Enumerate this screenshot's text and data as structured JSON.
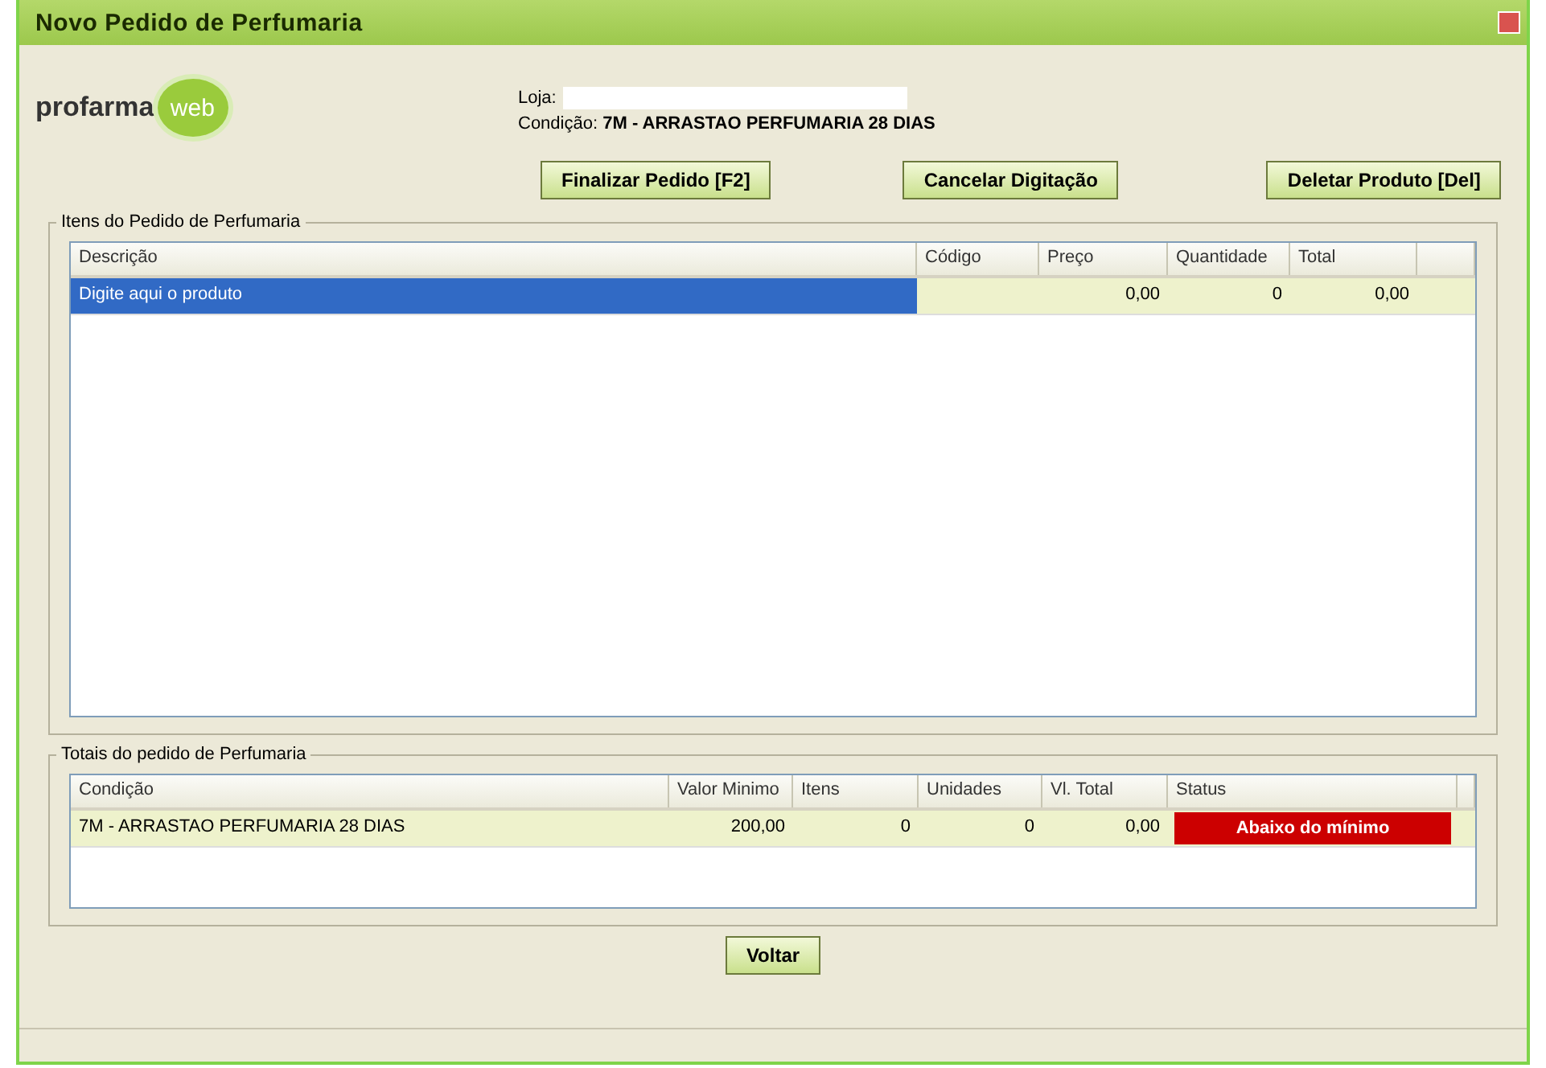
{
  "window": {
    "title": "Novo Pedido de Perfumaria"
  },
  "logo": {
    "text": "profarma",
    "badge": "web"
  },
  "header": {
    "store_label": "Loja:",
    "condition_label": "Condição:",
    "condition_value": "7M - ARRASTAO PERFUMARIA 28 DIAS"
  },
  "actions": [
    "Finalizar Pedido [F2]",
    "Cancelar Digitação",
    "Deletar Produto [Del]"
  ],
  "items": {
    "legend": "Itens do Pedido de Perfumaria",
    "columns": [
      "Descrição",
      "Código",
      "Preço",
      "Quantidade",
      "Total"
    ],
    "rows": [
      {
        "selected": true,
        "cells": [
          "Digite aqui o produto",
          null,
          "0,00",
          "0",
          "0,00"
        ]
      }
    ]
  },
  "totals": {
    "legend": "Totais do pedido de Perfumaria",
    "columns": [
      "Condição",
      "Valor Minimo",
      "Itens",
      "Unidades",
      "Vl. Total",
      "Status"
    ],
    "rows": [
      {
        "cells": [
          "7M - ARRASTAO PERFUMARIA 28 DIAS",
          "200,00",
          "0",
          "0",
          "0,00"
        ],
        "status": {
          "text": "Abaixo do mínimo",
          "color": "#cc0000"
        }
      }
    ]
  },
  "back_button": "Voltar"
}
